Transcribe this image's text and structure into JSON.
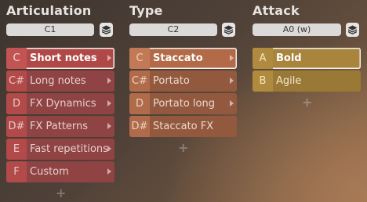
{
  "columns": [
    {
      "title": "Articulation",
      "trigger": "C1",
      "rows": [
        {
          "key": "C",
          "label": "Short notes",
          "selected": true,
          "submenu": true
        },
        {
          "key": "C#",
          "label": "Long notes",
          "selected": false,
          "submenu": true
        },
        {
          "key": "D",
          "label": "FX Dynamics",
          "selected": false,
          "submenu": true
        },
        {
          "key": "D#",
          "label": "FX Patterns",
          "selected": false,
          "submenu": true
        },
        {
          "key": "E",
          "label": "Fast repetitions",
          "selected": false,
          "submenu": true
        },
        {
          "key": "F",
          "label": "Custom",
          "selected": false,
          "submenu": true
        }
      ],
      "add_label": "+"
    },
    {
      "title": "Type",
      "trigger": "C2",
      "rows": [
        {
          "key": "C",
          "label": "Staccato",
          "selected": true,
          "submenu": true
        },
        {
          "key": "C#",
          "label": "Portato",
          "selected": false,
          "submenu": true
        },
        {
          "key": "D",
          "label": "Portato long",
          "selected": false,
          "submenu": true
        },
        {
          "key": "D#",
          "label": "Staccato FX",
          "selected": false,
          "submenu": false
        }
      ],
      "add_label": "+"
    },
    {
      "title": "Attack",
      "trigger": "A0 (w)",
      "rows": [
        {
          "key": "A",
          "label": "Bold",
          "selected": true,
          "submenu": false
        },
        {
          "key": "B",
          "label": "Agile",
          "selected": false,
          "submenu": false
        }
      ],
      "add_label": "+"
    }
  ],
  "icons": {
    "stack": "layers-icon",
    "arrow": "chevron-right-icon",
    "add": "plus-icon"
  }
}
